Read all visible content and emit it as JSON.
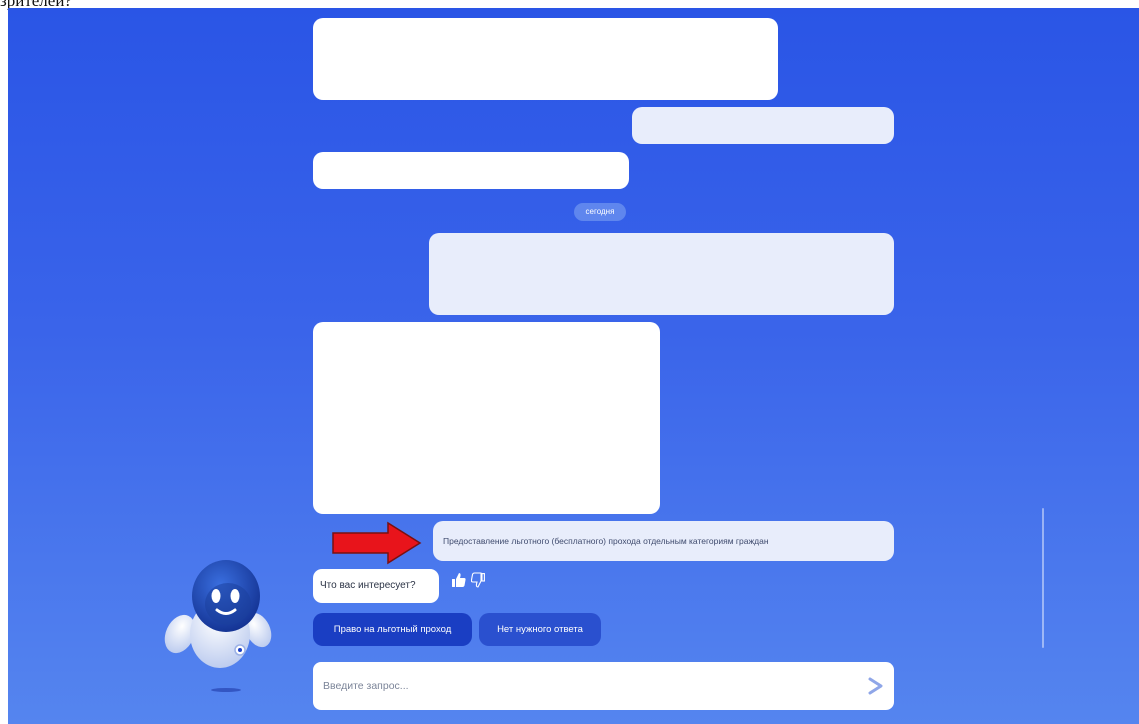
{
  "top_text": "зрителей?",
  "chat": {
    "date_label": "сегодня",
    "last_user_message": "Предоставление льготного (бесплатного) прохода отдельным категориям граждан",
    "bot_question": "Что вас интересует?",
    "quick_replies": [
      {
        "label": "Право на льготный проход"
      },
      {
        "label": "Нет нужного ответа"
      }
    ]
  },
  "input": {
    "placeholder": "Введите запрос..."
  },
  "icons": {
    "like": "thumbs-up-icon",
    "dislike": "thumbs-down-icon",
    "send": "send-arrow-icon",
    "annotation": "red-arrow-annotation"
  },
  "colors": {
    "background_top": "#2a55e6",
    "background_bottom": "#5585ef",
    "chip_primary": "#1a3ec3",
    "chip_secondary": "#2a50cf",
    "annotation_arrow": "#e8141b"
  }
}
